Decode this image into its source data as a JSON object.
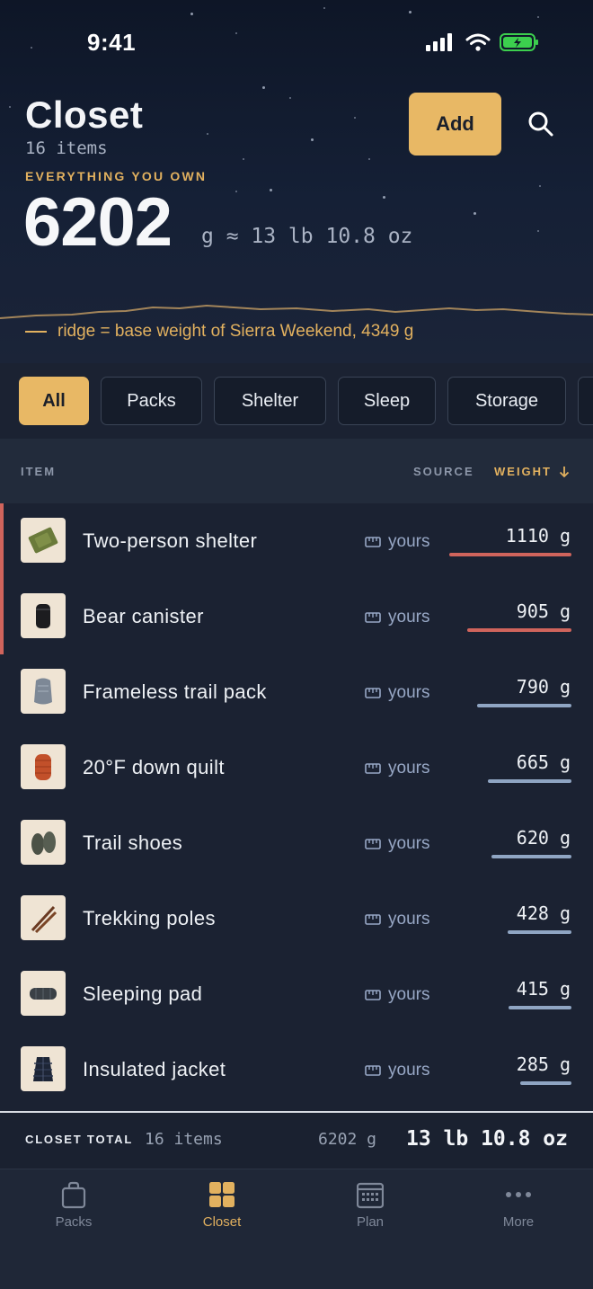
{
  "status_bar": {
    "time": "9:41"
  },
  "header": {
    "title": "Closet",
    "count": "16 items",
    "eyebrow": "EVERYTHING YOU OWN",
    "total_grams": "6202",
    "total_unit": "g ≈ 13 lb 10.8 oz",
    "add_label": "Add",
    "ridge_note": "ridge = base weight of Sierra Weekend, 4349 g"
  },
  "filters": [
    "All",
    "Packs",
    "Shelter",
    "Sleep",
    "Storage"
  ],
  "table": {
    "col_item": "ITEM",
    "col_source": "SOURCE",
    "col_weight": "WEIGHT",
    "rows": [
      {
        "name": "Two-person shelter",
        "source": "yours",
        "weight": "1110 g",
        "weight_value": 1110,
        "heavy": true
      },
      {
        "name": "Bear canister",
        "source": "yours",
        "weight": "905 g",
        "weight_value": 905,
        "heavy": true
      },
      {
        "name": "Frameless trail pack",
        "source": "yours",
        "weight": "790 g",
        "weight_value": 790,
        "heavy": false
      },
      {
        "name": "20°F down quilt",
        "source": "yours",
        "weight": "665 g",
        "weight_value": 665,
        "heavy": false
      },
      {
        "name": "Trail shoes",
        "source": "yours",
        "weight": "620 g",
        "weight_value": 620,
        "heavy": false
      },
      {
        "name": "Trekking poles",
        "source": "yours",
        "weight": "428 g",
        "weight_value": 428,
        "heavy": false
      },
      {
        "name": "Sleeping pad",
        "source": "yours",
        "weight": "415 g",
        "weight_value": 415,
        "heavy": false
      },
      {
        "name": "Insulated jacket",
        "source": "yours",
        "weight": "285 g",
        "weight_value": 285,
        "heavy": false
      }
    ]
  },
  "total": {
    "label": "CLOSET TOTAL",
    "count": "16 items",
    "grams": "6202 g",
    "imperial": "13 lb 10.8 oz"
  },
  "tabbar": [
    {
      "label": "Packs",
      "icon": "bag-icon"
    },
    {
      "label": "Closet",
      "icon": "grid-icon"
    },
    {
      "label": "Plan",
      "icon": "calendar-icon"
    },
    {
      "label": "More",
      "icon": "more-icon"
    }
  ],
  "colors": {
    "accent": "#e8b865",
    "heavy": "#d0645c",
    "normal": "#8fa5c3"
  }
}
